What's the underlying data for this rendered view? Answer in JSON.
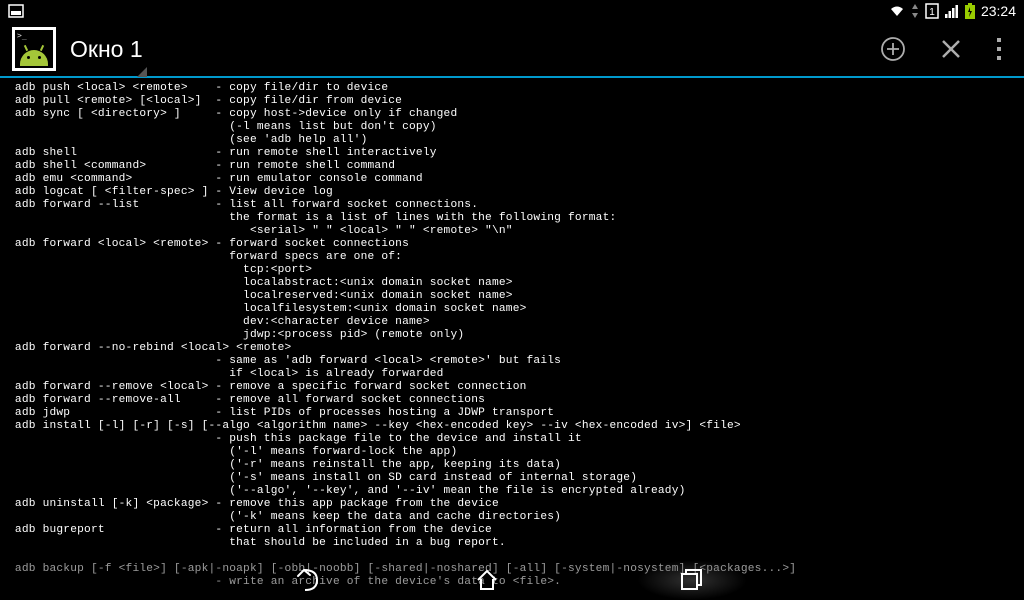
{
  "statusbar": {
    "time": "23:24"
  },
  "titlebar": {
    "tab_label": "Окно 1"
  },
  "terminal": {
    "lines": [
      " adb push <local> <remote>    - copy file/dir to device",
      " adb pull <remote> [<local>]  - copy file/dir from device",
      " adb sync [ <directory> ]     - copy host->device only if changed",
      "                                (-l means list but don't copy)",
      "                                (see 'adb help all')",
      " adb shell                    - run remote shell interactively",
      " adb shell <command>          - run remote shell command",
      " adb emu <command>            - run emulator console command",
      " adb logcat [ <filter-spec> ] - View device log",
      " adb forward --list           - list all forward socket connections.",
      "                                the format is a list of lines with the following format:",
      "                                   <serial> \" \" <local> \" \" <remote> \"\\n\"",
      " adb forward <local> <remote> - forward socket connections",
      "                                forward specs are one of:",
      "                                  tcp:<port>",
      "                                  localabstract:<unix domain socket name>",
      "                                  localreserved:<unix domain socket name>",
      "                                  localfilesystem:<unix domain socket name>",
      "                                  dev:<character device name>",
      "                                  jdwp:<process pid> (remote only)",
      " adb forward --no-rebind <local> <remote>",
      "                              - same as 'adb forward <local> <remote>' but fails",
      "                                if <local> is already forwarded",
      " adb forward --remove <local> - remove a specific forward socket connection",
      " adb forward --remove-all     - remove all forward socket connections",
      " adb jdwp                     - list PIDs of processes hosting a JDWP transport",
      " adb install [-l] [-r] [-s] [--algo <algorithm name> --key <hex-encoded key> --iv <hex-encoded iv>] <file>",
      "                              - push this package file to the device and install it",
      "                                ('-l' means forward-lock the app)",
      "                                ('-r' means reinstall the app, keeping its data)",
      "                                ('-s' means install on SD card instead of internal storage)",
      "                                ('--algo', '--key', and '--iv' mean the file is encrypted already)",
      " adb uninstall [-k] <package> - remove this app package from the device",
      "                                ('-k' means keep the data and cache directories)",
      " adb bugreport                - return all information from the device",
      "                                that should be included in a bug report.",
      "",
      " adb backup [-f <file>] [-apk|-noapk] [-obb|-noobb] [-shared|-noshared] [-all] [-system|-nosystem] [<packages...>]",
      "                              - write an archive of the device's data to <file>."
    ]
  }
}
